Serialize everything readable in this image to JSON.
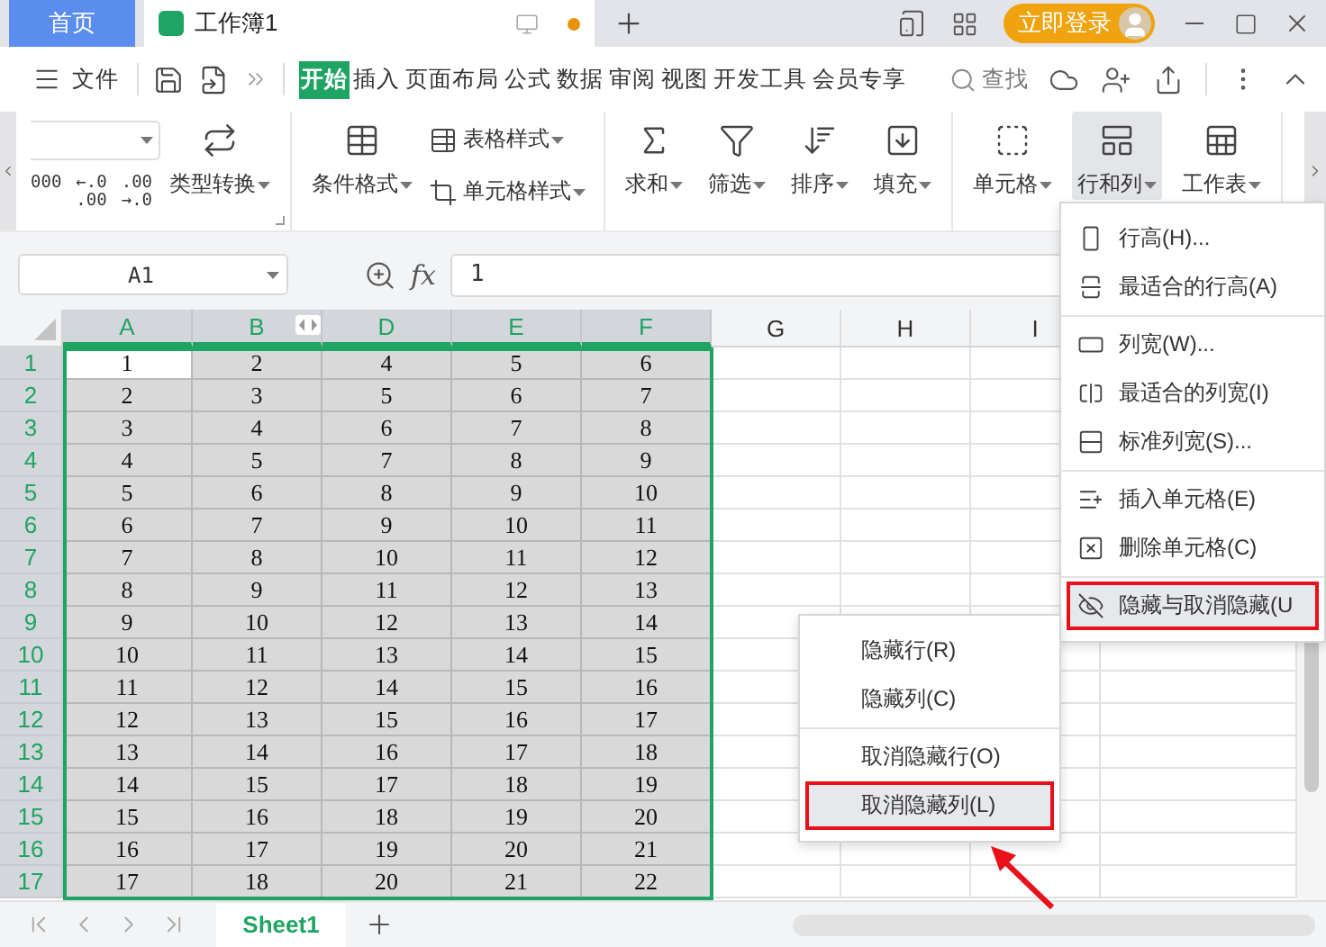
{
  "tabs": [
    {
      "label": "首页",
      "kind": "home",
      "selected": false
    },
    {
      "label": "工作簿1",
      "kind": "document",
      "selected": true
    }
  ],
  "login_button": "立即登录",
  "menu_bar": {
    "file": "文件",
    "search": "查找",
    "tabs": [
      {
        "label": "开始",
        "selected": true
      },
      {
        "label": "插入",
        "selected": false
      },
      {
        "label": "页面布局",
        "selected": false
      },
      {
        "label": "公式",
        "selected": false
      },
      {
        "label": "数据",
        "selected": false
      },
      {
        "label": "审阅",
        "selected": false
      },
      {
        "label": "视图",
        "selected": false
      },
      {
        "label": "开发工具",
        "selected": false
      },
      {
        "label": "会员专享",
        "selected": false
      }
    ]
  },
  "ribbon": {
    "number_formats": [
      {
        "lines": [
          "000"
        ]
      },
      {
        "lines": [
          "←.0",
          ".00"
        ]
      },
      {
        "lines": [
          ".00",
          "→.0"
        ]
      }
    ],
    "groups": [
      {
        "items": [
          {
            "label": "类型转换",
            "kind": "big",
            "selected": false
          }
        ]
      },
      {
        "items": [
          {
            "label": "条件格式",
            "kind": "big",
            "selected": false
          },
          {
            "label": "表格样式",
            "kind": "small",
            "selected": false
          },
          {
            "label": "单元格样式",
            "kind": "small",
            "selected": false
          }
        ]
      },
      {
        "items": [
          {
            "label": "求和",
            "kind": "big",
            "selected": false
          },
          {
            "label": "筛选",
            "kind": "big",
            "selected": false
          },
          {
            "label": "排序",
            "kind": "big",
            "selected": false
          },
          {
            "label": "填充",
            "kind": "big",
            "selected": false
          }
        ]
      },
      {
        "items": [
          {
            "label": "单元格",
            "kind": "big",
            "selected": false
          },
          {
            "label": "行和列",
            "kind": "big",
            "selected": true
          },
          {
            "label": "工作表",
            "kind": "big",
            "selected": false
          }
        ]
      }
    ]
  },
  "formula_bar": {
    "name_box": "A1",
    "fx_label": "fx",
    "formula": "1"
  },
  "sheet": {
    "columns": [
      {
        "label": "A",
        "selected": true,
        "hidden_after": false
      },
      {
        "label": "B",
        "selected": true,
        "hidden_after": true
      },
      {
        "label": "D",
        "selected": true,
        "hidden_after": false
      },
      {
        "label": "E",
        "selected": true,
        "hidden_after": false
      },
      {
        "label": "F",
        "selected": true,
        "hidden_after": false
      },
      {
        "label": "G",
        "selected": false,
        "hidden_after": false
      },
      {
        "label": "H",
        "selected": false,
        "hidden_after": false
      },
      {
        "label": "I",
        "selected": false
      }
    ],
    "rows": [
      {
        "label": "1",
        "selected": true,
        "cells": [
          {
            "value": "1",
            "active": true
          },
          {
            "value": "2",
            "active": false
          },
          {
            "value": "4",
            "active": false
          },
          {
            "value": "5",
            "active": false
          },
          {
            "value": "6",
            "active": false
          }
        ]
      },
      {
        "label": "2",
        "selected": true,
        "cells": [
          {
            "value": "2",
            "active": false
          },
          {
            "value": "3",
            "active": false
          },
          {
            "value": "5",
            "active": false
          },
          {
            "value": "6",
            "active": false
          },
          {
            "value": "7",
            "active": false
          }
        ]
      },
      {
        "label": "3",
        "selected": true,
        "cells": [
          {
            "value": "3",
            "active": false
          },
          {
            "value": "4",
            "active": false
          },
          {
            "value": "6",
            "active": false
          },
          {
            "value": "7",
            "active": false
          },
          {
            "value": "8",
            "active": false
          }
        ]
      },
      {
        "label": "4",
        "selected": true,
        "cells": [
          {
            "value": "4",
            "active": false
          },
          {
            "value": "5",
            "active": false
          },
          {
            "value": "7",
            "active": false
          },
          {
            "value": "8",
            "active": false
          },
          {
            "value": "9",
            "active": false
          }
        ]
      },
      {
        "label": "5",
        "selected": true,
        "cells": [
          {
            "value": "5",
            "active": false
          },
          {
            "value": "6",
            "active": false
          },
          {
            "value": "8",
            "active": false
          },
          {
            "value": "9",
            "active": false
          },
          {
            "value": "10",
            "active": false
          }
        ]
      },
      {
        "label": "6",
        "selected": true,
        "cells": [
          {
            "value": "6",
            "active": false
          },
          {
            "value": "7",
            "active": false
          },
          {
            "value": "9",
            "active": false
          },
          {
            "value": "10",
            "active": false
          },
          {
            "value": "11",
            "active": false
          }
        ]
      },
      {
        "label": "7",
        "selected": true,
        "cells": [
          {
            "value": "7",
            "active": false
          },
          {
            "value": "8",
            "active": false
          },
          {
            "value": "10",
            "active": false
          },
          {
            "value": "11",
            "active": false
          },
          {
            "value": "12",
            "active": false
          }
        ]
      },
      {
        "label": "8",
        "selected": true,
        "cells": [
          {
            "value": "8",
            "active": false
          },
          {
            "value": "9",
            "active": false
          },
          {
            "value": "11",
            "active": false
          },
          {
            "value": "12",
            "active": false
          },
          {
            "value": "13",
            "active": false
          }
        ]
      },
      {
        "label": "9",
        "selected": true,
        "cells": [
          {
            "value": "9",
            "active": false
          },
          {
            "value": "10",
            "active": false
          },
          {
            "value": "12",
            "active": false
          },
          {
            "value": "13",
            "active": false
          },
          {
            "value": "14",
            "active": false
          }
        ]
      },
      {
        "label": "10",
        "selected": true,
        "cells": [
          {
            "value": "10",
            "active": false
          },
          {
            "value": "11",
            "active": false
          },
          {
            "value": "13",
            "active": false
          },
          {
            "value": "14",
            "active": false
          },
          {
            "value": "15",
            "active": false
          }
        ]
      },
      {
        "label": "11",
        "selected": true,
        "cells": [
          {
            "value": "11",
            "active": false
          },
          {
            "value": "12",
            "active": false
          },
          {
            "value": "14",
            "active": false
          },
          {
            "value": "15",
            "active": false
          },
          {
            "value": "16",
            "active": false
          }
        ]
      },
      {
        "label": "12",
        "selected": true,
        "cells": [
          {
            "value": "12",
            "active": false
          },
          {
            "value": "13",
            "active": false
          },
          {
            "value": "15",
            "active": false
          },
          {
            "value": "16",
            "active": false
          },
          {
            "value": "17",
            "active": false
          }
        ]
      },
      {
        "label": "13",
        "selected": true,
        "cells": [
          {
            "value": "13",
            "active": false
          },
          {
            "value": "14",
            "active": false
          },
          {
            "value": "16",
            "active": false
          },
          {
            "value": "17",
            "active": false
          },
          {
            "value": "18",
            "active": false
          }
        ]
      },
      {
        "label": "14",
        "selected": true,
        "cells": [
          {
            "value": "14",
            "active": false
          },
          {
            "value": "15",
            "active": false
          },
          {
            "value": "17",
            "active": false
          },
          {
            "value": "18",
            "active": false
          },
          {
            "value": "19",
            "active": false
          }
        ]
      },
      {
        "label": "15",
        "selected": true,
        "cells": [
          {
            "value": "15",
            "active": false
          },
          {
            "value": "16",
            "active": false
          },
          {
            "value": "18",
            "active": false
          },
          {
            "value": "19",
            "active": false
          },
          {
            "value": "20",
            "active": false
          }
        ]
      },
      {
        "label": "16",
        "selected": true,
        "cells": [
          {
            "value": "16",
            "active": false
          },
          {
            "value": "17",
            "active": false
          },
          {
            "value": "19",
            "active": false
          },
          {
            "value": "20",
            "active": false
          },
          {
            "value": "21",
            "active": false
          }
        ]
      },
      {
        "label": "17",
        "selected": true,
        "cells": [
          {
            "value": "17",
            "active": false
          },
          {
            "value": "18",
            "active": false
          },
          {
            "value": "20",
            "active": false
          },
          {
            "value": "21",
            "active": false
          },
          {
            "value": "22",
            "active": false
          }
        ]
      }
    ]
  },
  "sheet_tabs": [
    {
      "label": "Sheet1",
      "selected": true
    }
  ],
  "row_col_menu": {
    "groups": [
      [
        {
          "label": "行高(H)...",
          "selected": false,
          "marked": false
        },
        {
          "label": "最适合的行高(A)",
          "selected": false,
          "marked": false
        }
      ],
      [
        {
          "label": "列宽(W)...",
          "selected": false,
          "marked": false
        },
        {
          "label": "最适合的列宽(I)",
          "selected": false,
          "marked": false
        },
        {
          "label": "标准列宽(S)...",
          "selected": false,
          "marked": false
        }
      ],
      [
        {
          "label": "插入单元格(E)",
          "selected": false,
          "marked": false
        },
        {
          "label": "删除单元格(C)",
          "selected": false,
          "marked": false
        }
      ],
      [
        {
          "label": "隐藏与取消隐藏(U",
          "selected": true,
          "marked": true
        }
      ]
    ]
  },
  "hide_submenu": {
    "groups": [
      [
        {
          "label": "隐藏行(R)",
          "selected": false,
          "marked": false
        },
        {
          "label": "隐藏列(C)",
          "selected": false,
          "marked": false
        }
      ],
      [
        {
          "label": "取消隐藏行(O)",
          "selected": false,
          "marked": false
        },
        {
          "label": "取消隐藏列(L)",
          "selected": true,
          "marked": true
        }
      ]
    ]
  }
}
